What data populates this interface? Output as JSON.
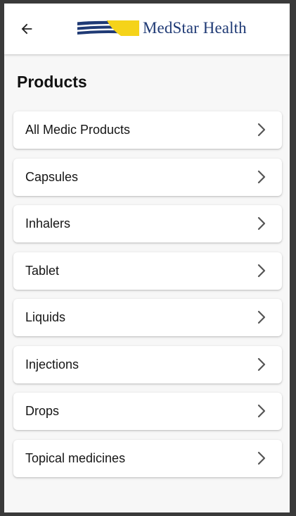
{
  "header": {
    "back_icon": "arrow-left-icon",
    "logo_text": "MedStar Health",
    "logo_colors": {
      "navy": "#1f3a75",
      "yellow": "#f5d31a"
    }
  },
  "page": {
    "title": "Products"
  },
  "products": [
    {
      "label": "All Medic Products",
      "icon": "chevron-right-icon"
    },
    {
      "label": "Capsules",
      "icon": "chevron-right-icon"
    },
    {
      "label": "Inhalers",
      "icon": "chevron-right-icon"
    },
    {
      "label": "Tablet",
      "icon": "chevron-right-icon"
    },
    {
      "label": "Liquids",
      "icon": "chevron-right-icon"
    },
    {
      "label": "Injections",
      "icon": "chevron-right-icon"
    },
    {
      "label": "Drops",
      "icon": "chevron-right-icon"
    },
    {
      "label": "Topical medicines",
      "icon": "chevron-right-icon"
    }
  ]
}
